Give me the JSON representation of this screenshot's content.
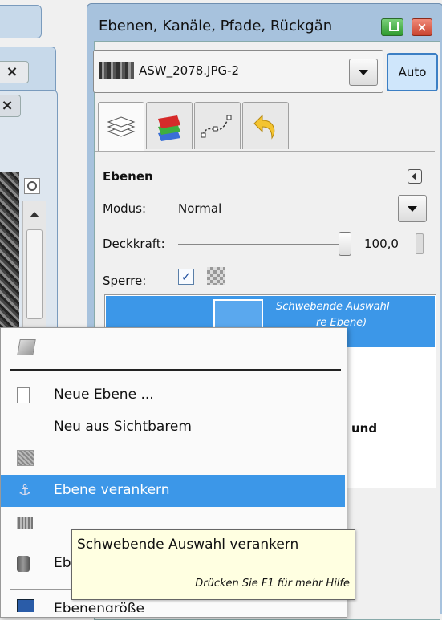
{
  "dock": {
    "title": "Ebenen, Kanäle, Pfade, Rückgän",
    "image_name": "ASW_2078.JPG-2",
    "auto_label": "Auto"
  },
  "layers_panel": {
    "heading": "Ebenen",
    "mode_label": "Modus:",
    "mode_value": "Normal",
    "opacity_label": "Deckkraft:",
    "opacity_value": "100,0",
    "opacity_fraction": 1.0,
    "lock_label": "Sperre:",
    "layer_name_line1": "Schwebende Auswahl",
    "layer_name_line2": "re Ebene)",
    "partial_text": "und"
  },
  "context_menu": {
    "items": [
      {
        "label": "Neue Ebene ..."
      },
      {
        "label": "Neu aus Sichtbarem"
      },
      {
        "label": "Ebene verankern"
      },
      {
        "label": "Eb"
      },
      {
        "label": "Ebenengröße"
      }
    ]
  },
  "tooltip": {
    "title": "Schwebende Auswahl verankern",
    "help": "Drücken Sie F1 für mehr Hilfe"
  },
  "icons": [
    "document-icon",
    "anchor-icon",
    "layer-icon",
    "channels-icon",
    "paths-icon",
    "undo-icon",
    "chain-icon",
    "eye-icon",
    "merge-icon",
    "delete-icon"
  ]
}
